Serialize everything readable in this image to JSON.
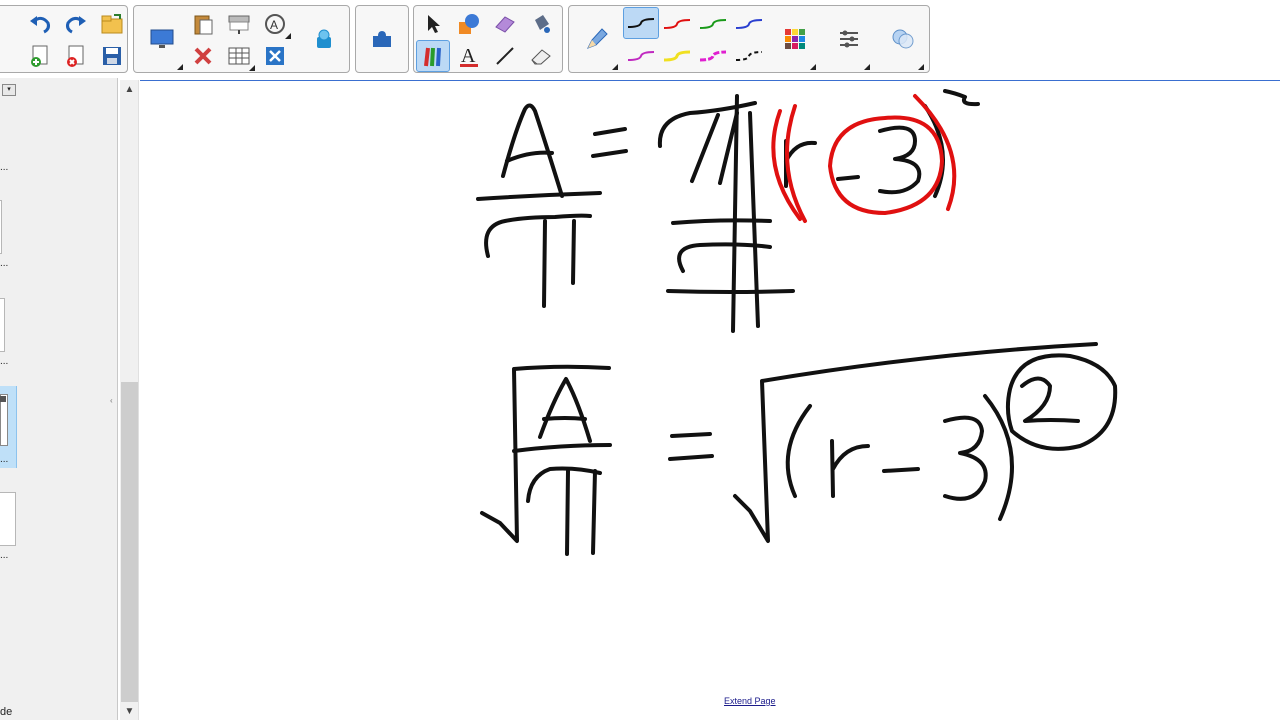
{
  "sidebar": {
    "labels": [
      "...",
      "...",
      "...",
      "...",
      "...",
      "de"
    ]
  },
  "canvas": {
    "extend_link": "Extend Page"
  },
  "colors": {
    "ink_black": "#111111",
    "ink_red": "#e01010",
    "selected_button": "#bcd9f5",
    "canvas_border": "#3a6fd0"
  },
  "toolbar": {
    "icons": [
      "undo-icon",
      "redo-icon",
      "open-file-icon",
      "add-page-icon",
      "delete-page-icon",
      "save-icon",
      "paste-icon",
      "delete-icon",
      "screen-shade-icon",
      "table-icon",
      "measurement-tools-icon",
      "fit-icon",
      "display-icon",
      "doc-camera-icon",
      "addons-icon",
      "select-icon",
      "shapes-icon",
      "eraser-icon",
      "fill-icon",
      "pen-icon",
      "text-icon",
      "line-icon",
      "eraser-tool-icon",
      "pencil-icon",
      "color-palette-icon",
      "properties-icon",
      "fill-effects-icon"
    ]
  }
}
